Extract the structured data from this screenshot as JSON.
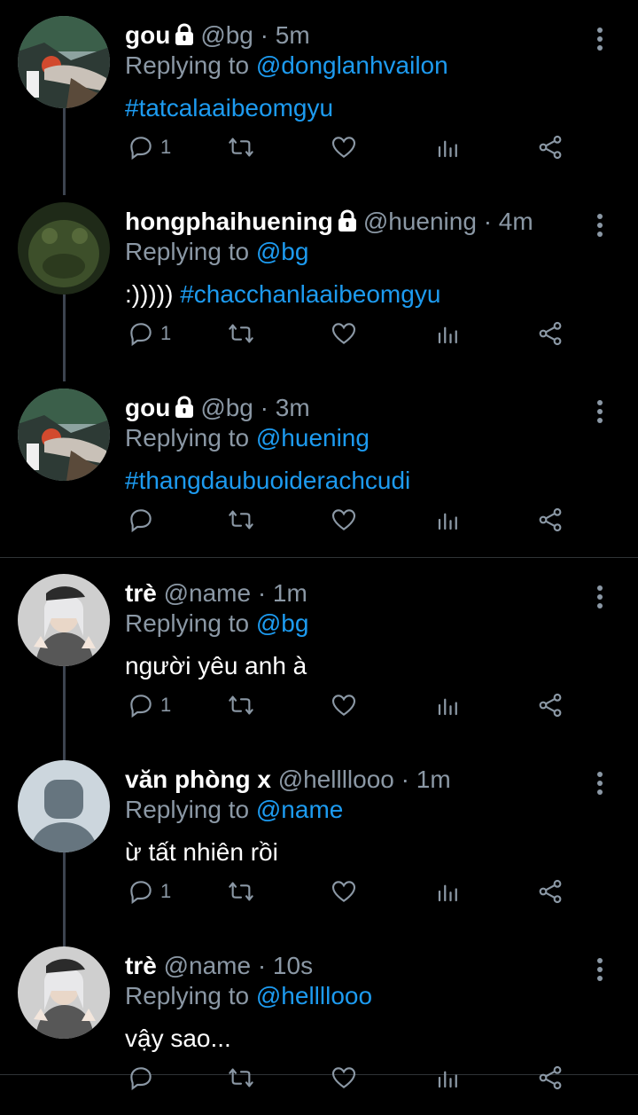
{
  "tweets": [
    {
      "name": "gou",
      "locked": true,
      "handle": "@bg",
      "time": "· 5m",
      "replying_prefix": "Replying to",
      "replying_to": "@donglanhvailon",
      "text_plain": "",
      "text_tag": "#tatcalaaibeomgyu",
      "reply_count": "1",
      "avatar": "cartoon"
    },
    {
      "name": "hongphaihuening",
      "locked": true,
      "handle": "@huening",
      "time": "· 4m",
      "replying_prefix": "Replying to",
      "replying_to": "@bg",
      "text_plain": ":))))) ",
      "text_tag": "#chacchanlaaibeomgyu",
      "reply_count": "1",
      "avatar": "frog"
    },
    {
      "name": "gou",
      "locked": true,
      "handle": "@bg",
      "time": "· 3m",
      "replying_prefix": "Replying to",
      "replying_to": "@huening",
      "text_plain": "",
      "text_tag": "#thangdaubuoiderachcudi",
      "reply_count": "",
      "avatar": "cartoon"
    },
    {
      "name": "trè",
      "locked": false,
      "handle": "@name",
      "time": "· 1m",
      "replying_prefix": "Replying to",
      "replying_to": "@bg",
      "text_plain": "người yêu anh à",
      "text_tag": "",
      "reply_count": "1",
      "avatar": "person"
    },
    {
      "name": "văn phòng x",
      "locked": false,
      "handle": "@hellllooo",
      "time": "· 1m",
      "replying_prefix": "Replying to",
      "replying_to": "@name",
      "text_plain": "ừ tất nhiên rồi",
      "text_tag": "",
      "reply_count": "1",
      "avatar": "default"
    },
    {
      "name": "trè",
      "locked": false,
      "handle": "@name",
      "time": "· 10s",
      "replying_prefix": "Replying to",
      "replying_to": "@hellllooo",
      "text_plain": "vậy sao...",
      "text_tag": "",
      "reply_count": "",
      "avatar": "person"
    }
  ],
  "colors": {
    "background": "#000000",
    "text": "#ffffff",
    "muted": "#8b98a5",
    "accent": "#1d9bf0",
    "thread": "#3d4450"
  },
  "icons": {
    "reply": "reply-icon",
    "retweet": "retweet-icon",
    "like": "like-icon",
    "analytics": "analytics-icon",
    "share": "share-icon",
    "more": "more-icon",
    "lock": "lock-icon"
  }
}
